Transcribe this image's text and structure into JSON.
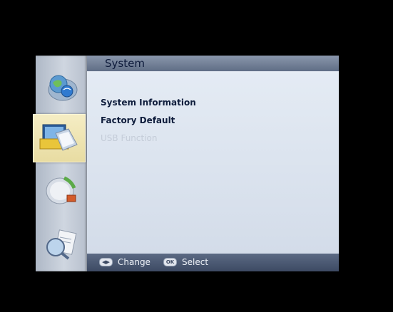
{
  "panel": {
    "title": "System"
  },
  "menu": {
    "items": [
      {
        "label": "System Information",
        "enabled": true
      },
      {
        "label": "Factory Default",
        "enabled": true
      },
      {
        "label": "USB Function",
        "enabled": false
      }
    ]
  },
  "sidebar": {
    "items": [
      {
        "icon": "globe-satellite-icon",
        "active": false
      },
      {
        "icon": "folder-settings-icon",
        "active": true
      },
      {
        "icon": "satellite-dish-icon",
        "active": false
      },
      {
        "icon": "magnifier-document-icon",
        "active": false
      }
    ]
  },
  "footer": {
    "change_label": "Change",
    "select_label": "Select",
    "change_key": "◀▶",
    "select_key": "OK"
  },
  "colors": {
    "background": "#000000",
    "header": "#6e7b93",
    "body": "#dfe6f0",
    "footer": "#4a5770",
    "active_tab": "#efe5b6"
  }
}
